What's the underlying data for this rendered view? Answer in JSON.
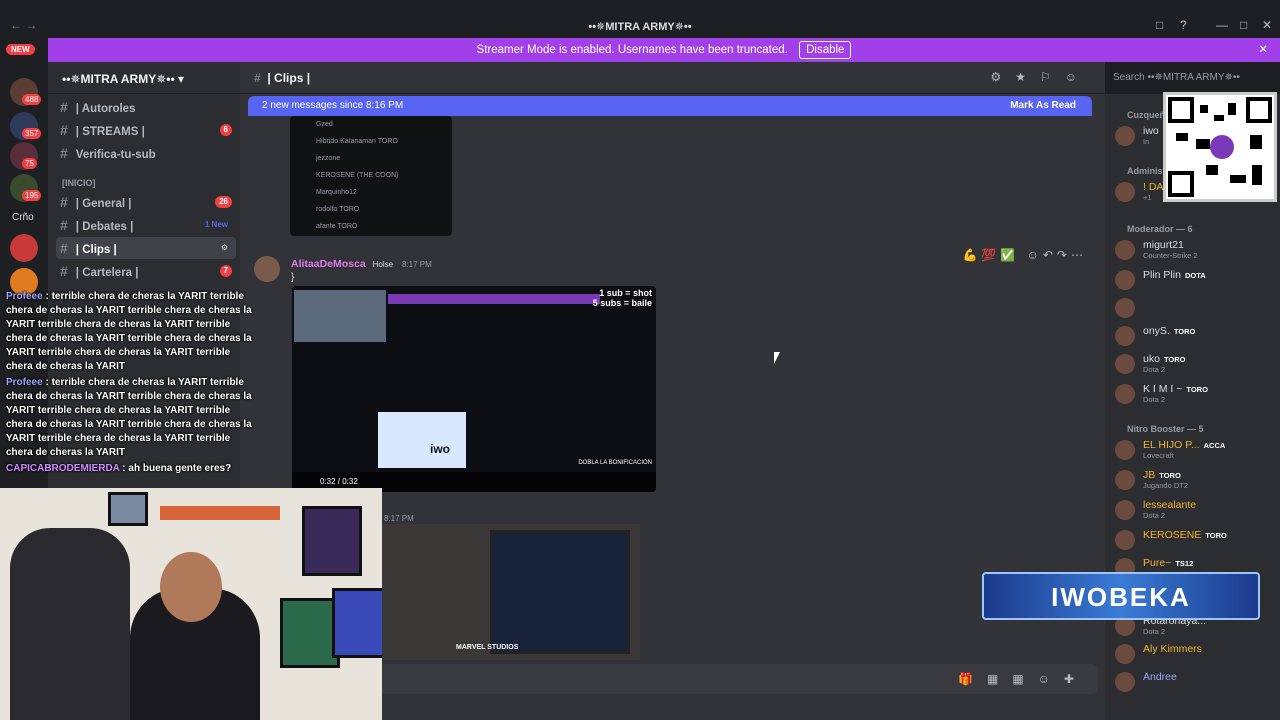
{
  "window": {
    "title": "••✵MITRA ARMY✵••"
  },
  "banner": {
    "text": "Streamer Mode is enabled. Usernames have been truncated.",
    "button": "Disable"
  },
  "servers": {
    "new_label": "NEW",
    "badges": [
      "488",
      "357",
      "75",
      "195"
    ],
    "text_label": "Crño"
  },
  "guild": {
    "name": "••✵MITRA ARMY✵••"
  },
  "channels": [
    {
      "name": "| Autoroles",
      "count": ""
    },
    {
      "name": "| STREAMS |",
      "count": "6"
    },
    {
      "name": "Verifica-tu-sub",
      "count": ""
    }
  ],
  "category": "[INICIO]",
  "channels2": [
    {
      "name": "| General |",
      "count": "26"
    },
    {
      "name": "| Debates |",
      "count": "1 New"
    },
    {
      "name": "| Clips |",
      "count": ""
    },
    {
      "name": "| Cartelera |",
      "count": "7"
    }
  ],
  "topbar": {
    "channel": "| Clips |",
    "search_placeholder": "Search ••✵MITRA ARMY✵••"
  },
  "newmessages": {
    "text": "2 new messages since 8:16 PM",
    "action": "Mark As Read"
  },
  "embed_rows": [
    "Gzed",
    "Hibrido.Katanaman  TORO",
    "jezzone",
    "KEROSENE (THE COON)",
    "Marquinho12",
    "rodolfo  TORO",
    "afante  TORO"
  ],
  "message": {
    "author": "AlitaaDeMosca",
    "tag": "Holse",
    "time": "8:17 PM",
    "text": "}"
  },
  "video": {
    "time": "0:32 / 0:32",
    "hud_line1": "1 sub = shot",
    "hud_line2": "5 subs = baile",
    "overlay_name": "iwo",
    "overlay_text": "DOBLA LA BONIFICACION"
  },
  "message2": {
    "time": "8:17 PM",
    "brand": "MARVEL STUDIOS"
  },
  "members": {
    "sections": [
      {
        "header": "Cuzqueñ...",
        "items": [
          {
            "name": "iwo",
            "sub": "In"
          }
        ]
      },
      {
        "header": "Administ...",
        "items": [
          {
            "name": "! DA",
            "sub": "+1"
          }
        ]
      },
      {
        "header": "Moderador — 6",
        "items": [
          {
            "name": "migurt21",
            "sub": "Counter-Strike 2",
            "tag": ""
          },
          {
            "name": "Plin Plin",
            "sub": "",
            "tag": "DOTA"
          },
          {
            "name": "",
            "sub": "",
            "tag": ""
          },
          {
            "name": "onyS.",
            "sub": "",
            "tag": "TORO"
          },
          {
            "name": "uko",
            "sub": "Dota 2",
            "tag": "TORO"
          },
          {
            "name": "K I M I ~",
            "sub": "Dota 2",
            "tag": "TORO"
          }
        ]
      },
      {
        "header": "Nitro Booster — 5",
        "items": [
          {
            "name": "EL HIJO P...",
            "sub": "Lovecraft",
            "tag": "ACCA"
          },
          {
            "name": "JB",
            "sub": "Jugando DT2",
            "tag": "TORO"
          },
          {
            "name": "lessealante",
            "sub": "Dota 2",
            "tag": ""
          },
          {
            "name": "KEROSENE",
            "sub": "",
            "tag": "TORO"
          },
          {
            "name": "Pure~",
            "sub": "",
            "tag": "TS12"
          },
          {
            "name": "Rotaronaya...",
            "sub": "Dota 2",
            "tag": ""
          },
          {
            "name": "Aly Kimmers",
            "sub": "",
            "tag": ""
          },
          {
            "name": "Andree",
            "sub": "",
            "tag": ""
          }
        ]
      }
    ]
  },
  "overlay": {
    "name": "IWOBEKA"
  },
  "chat": [
    {
      "user": "Profeee",
      "text": "terrible chera de cheras la YARIT terrible chera de cheras la YARIT terrible chera de cheras la YARIT terrible chera de cheras la YARIT terrible chera de cheras la YARIT terrible chera de cheras la YARIT terrible chera de cheras la YARIT terrible chera de cheras la YARIT"
    },
    {
      "user": "Profeee",
      "text": "terrible chera de cheras la YARIT terrible chera de cheras la YARIT terrible chera de cheras la YARIT terrible chera de cheras la YARIT terrible chera de cheras la YARIT terrible chera de cheras la YARIT terrible chera de cheras la YARIT terrible chera de cheras la YARIT"
    },
    {
      "user": "CAPICABRODEMIERDA",
      "text": "ah buena gente eres?"
    }
  ],
  "colors": {
    "accent": "#5865f2",
    "streamer_banner": "#a140e8",
    "mention": "#f23f43"
  }
}
